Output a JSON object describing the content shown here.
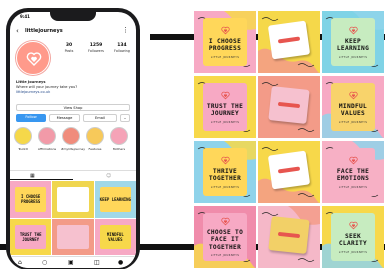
{
  "phone": {
    "status_time": "9:41",
    "username": "littlejourneys",
    "stats": [
      {
        "value": "30",
        "label": "Posts"
      },
      {
        "value": "1259",
        "label": "Followers"
      },
      {
        "value": "134",
        "label": "Following"
      }
    ],
    "bio": {
      "name": "Little Journeys",
      "line": "Where will your journey take you?",
      "link": "littlejourneys.co.uk"
    },
    "buttons": {
      "view_shop": "View Shop",
      "follow": "Follow",
      "message": "Message",
      "email": "Email",
      "dropdown": "⌄"
    },
    "highlights": [
      {
        "label": "Toolkit",
        "color": "#f5d84a"
      },
      {
        "label": "Affirmations",
        "color": "#f29aa8"
      },
      {
        "label": "#myliltejourney",
        "color": "#f08c7c"
      },
      {
        "label": "Features",
        "color": "#f7c95a"
      },
      {
        "label": "Mothers",
        "color": "#f5a3b7"
      }
    ],
    "mini_posts": [
      {
        "text": "I CHOOSE PROGRESS",
        "bg": "#f7a9c4",
        "card": "#ffd75a"
      },
      {
        "text": "",
        "bg": "#f0d64f",
        "card": "#ffffff"
      },
      {
        "text": "KEEP LEARNING",
        "bg": "#a0d8e8",
        "card": "#ffd75a"
      },
      {
        "text": "TRUST THE JOURNEY",
        "bg": "#f7d84a",
        "card": "#f7a9c4"
      },
      {
        "text": "",
        "bg": "#f39b88",
        "card": "#f6c1cf"
      },
      {
        "text": "MINDFUL VALUES",
        "bg": "#f7a9c4",
        "card": "#f7d84a"
      }
    ]
  },
  "grid": [
    {
      "text": "I CHOOSE PROGRESS",
      "brand": "LITTLE JOURNEYS",
      "bg": "#f7a9c4",
      "card": "#ffd75a",
      "kind": "quote"
    },
    {
      "text": "",
      "brand": "",
      "bg": "#f5d84a",
      "card": "#ffffff",
      "kind": "photo"
    },
    {
      "text": "KEEP LEARNING",
      "brand": "LITTLE JOURNEYS",
      "bg": "#7fd3e6",
      "card": "#c7ecc0",
      "kind": "quote"
    },
    {
      "text": "TRUST THE JOURNEY",
      "brand": "LITTLE JOURNEYS",
      "bg": "#f7d84a",
      "card": "#f7a9c4",
      "kind": "quote"
    },
    {
      "text": "",
      "brand": "",
      "bg": "#f39b88",
      "card": "#f6c1cf",
      "kind": "photo"
    },
    {
      "text": "MINDFUL VALUES",
      "brand": "LITTLE JOURNEYS",
      "bg": "#f7a9c4",
      "card": "#f8d36b",
      "kind": "quote"
    },
    {
      "text": "THRIVE TOGETHER",
      "brand": "LITTLE JOURNEYS",
      "bg": "#8fd3ea",
      "card": "#ffd75a",
      "kind": "quote"
    },
    {
      "text": "",
      "brand": "",
      "bg": "#f7d84a",
      "card": "#ffffff",
      "kind": "photo"
    },
    {
      "text": "FACE THE EMOTIONS",
      "brand": "LITTLE JOURNEYS",
      "bg": "#f7b0c5",
      "card": "#f7b0c5",
      "kind": "quote"
    },
    {
      "text": "CHOOSE TO FACE IT TOGETHER",
      "brand": "LITTLE JOURNEYS",
      "bg": "#f08cab",
      "card": "#f7a9c4",
      "kind": "quote"
    },
    {
      "text": "",
      "brand": "",
      "bg": "#f5b8c8",
      "card": "#f2d067",
      "kind": "photo"
    },
    {
      "text": "SEEK CLARITY",
      "brand": "LITTLE JOURNEYS",
      "bg": "#f7d84a",
      "card": "#c7ecc0",
      "kind": "quote"
    }
  ]
}
